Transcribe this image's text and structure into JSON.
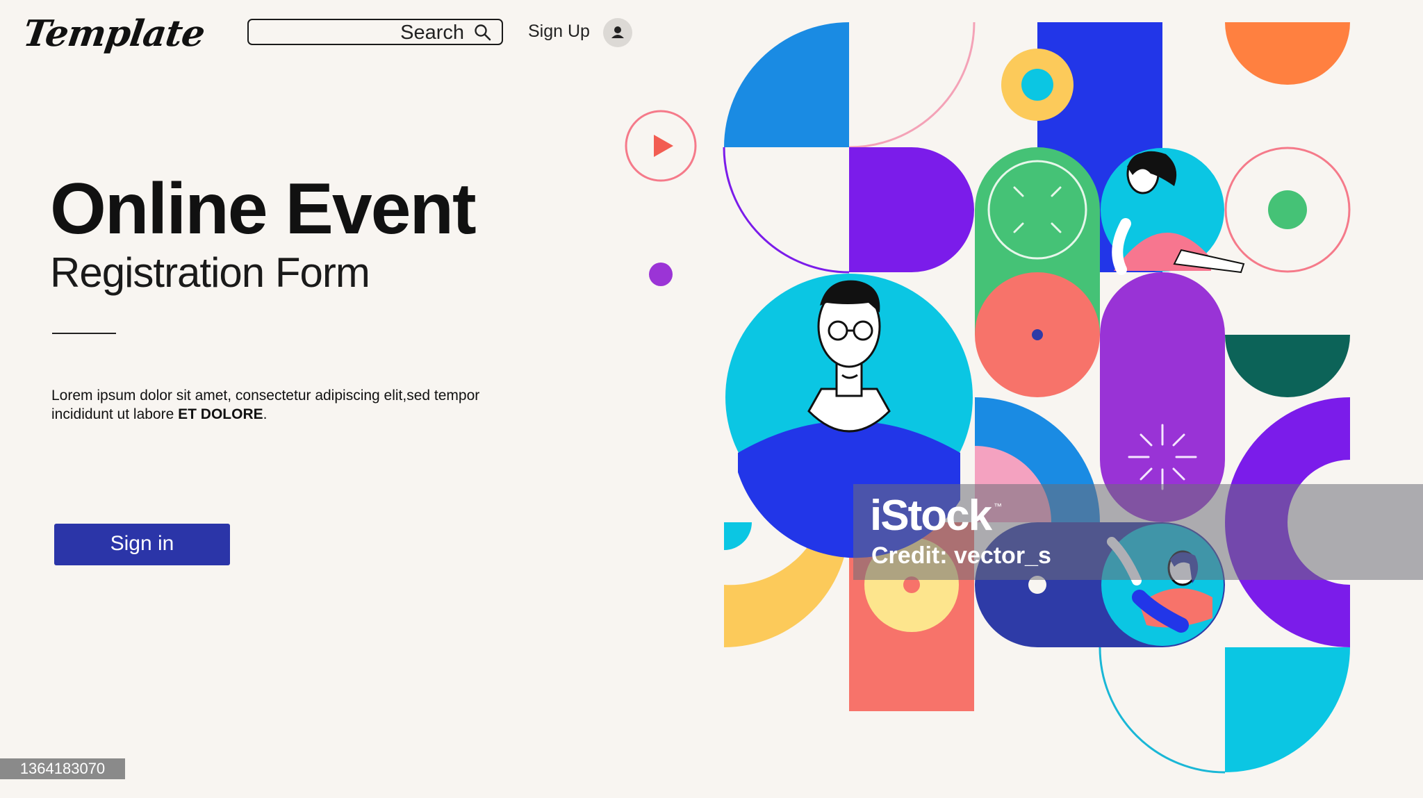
{
  "header": {
    "logo_text": "Template",
    "search": {
      "label": "Search",
      "placeholder": ""
    },
    "signup_label": "Sign Up"
  },
  "hero": {
    "title": "Online Event",
    "subtitle": "Registration Form",
    "body_text": "Lorem ipsum dolor sit amet, consectetur adipiscing elit,sed tempor incididunt ut labore",
    "body_emphasis": "ET DOLORE",
    "body_end": ".",
    "signin_label": "Sign in"
  },
  "watermark": {
    "brand": "iStock",
    "tm": "™",
    "credit": "Credit: vector_s",
    "image_id": "1364183070"
  },
  "colors": {
    "background": "#f8f5f1",
    "signin_button": "#2b35a8",
    "blue": "#1a8be3",
    "royal_blue": "#2236e8",
    "purple": "#7b1cea",
    "violet": "#9933d6",
    "green": "#45c276",
    "coral": "#f7736a",
    "cyan": "#0bc6e3",
    "yellow": "#fcca5a",
    "orange": "#ff8040",
    "teal_dark": "#0c6358",
    "navy": "#2e3ba7"
  }
}
